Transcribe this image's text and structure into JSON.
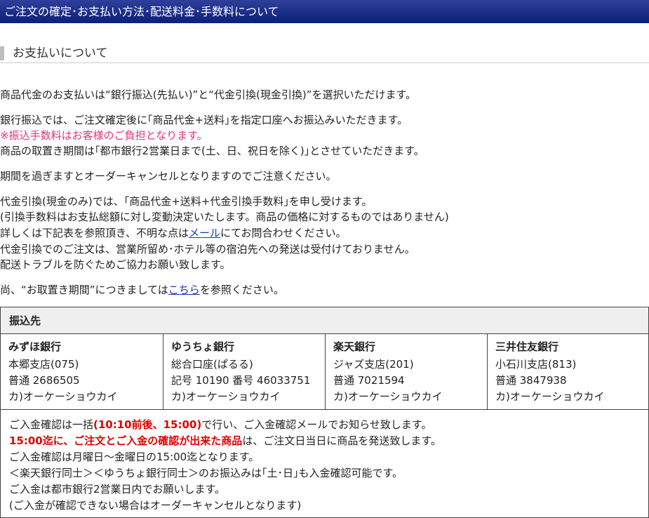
{
  "header": {
    "title": "ご注文の確定･お支払い方法･配送料金･手数料について"
  },
  "section": {
    "title": "お支払いについて"
  },
  "paragraphs": {
    "p1": "商品代金のお支払いは“銀行振込(先払い)”と“代金引換(現金引換)”を選択いただけます。",
    "p2": "銀行振込では、ご注文確定後に｢商品代金+送料｣を指定口座へお振込みいただきます。",
    "p3": "※振込手数料はお客様のご負担となります。",
    "p4": "商品の取置き期間は｢都市銀行2営業日まで(土、日、祝日を除く)｣とさせていただきます。",
    "p5": "期間を過ぎますとオーダーキャンセルとなりますのでご注意ください。",
    "p6": "代金引換(現金のみ)では、｢商品代金+送料+代金引換手数料｣を申し受けます。",
    "p7": "(引換手数料はお支払総額に対し変動決定いたします。商品の価格に対するものではありません)",
    "p8a": "詳しくは下記表を参照頂き、不明な点は",
    "p8link": "メール",
    "p8b": "にてお問合わせください。",
    "p9": "代金引換でのご注文は、営業所留め･ホテル等の宿泊先への発送は受付けておりません。",
    "p10": "配送トラブルを防ぐためご協力お願い致します。",
    "p11a": "尚、“お取置き期間”につきましては",
    "p11link": "こちら",
    "p11b": "を参照ください。"
  },
  "table": {
    "header": "振込先",
    "banks": [
      {
        "name": "みずほ銀行",
        "branch": "本郷支店(075)",
        "account": "普通 2686505",
        "holder": "カ)オーケーショウカイ"
      },
      {
        "name": "ゆうちょ銀行",
        "branch": "総合口座(ぱるる)",
        "account": "記号 10190 番号 46033751",
        "holder": "カ)オーケーショウカイ"
      },
      {
        "name": "楽天銀行",
        "branch": "ジャズ支店(201)",
        "account": "普通 7021594",
        "holder": "カ)オーケーショウカイ"
      },
      {
        "name": "三井住友銀行",
        "branch": "小石川支店(813)",
        "account": "普通 3847938",
        "holder": "カ)オーケーショウカイ"
      }
    ],
    "notes": {
      "n1a": "ご入金確認は一括",
      "n1red": "(10:10前後、15:00)",
      "n1b": "で行い、ご入金確認メールでお知らせ致します。",
      "n2red": "15:00迄に、ご注文とご入金の確認が出来た商品",
      "n2b": "は、ご注文日当日に商品を発送致します。",
      "n3": "ご入金確認は月曜日～金曜日の15:00迄となります。",
      "n4": "＜楽天銀行同士＞＜ゆうちょ銀行同士＞のお振込みは｢土･日｣も入金確認可能です。",
      "n5": "ご入金は都市銀行2営業日内でお願いします。",
      "n6": "(ご入金が確認できない場合はオーダーキャンセルとなります)"
    }
  },
  "colors": {
    "header_bg": "#0b1f7a",
    "accent_pink": "#e0347a",
    "accent_red": "#e00000",
    "link": "#1a37b8"
  }
}
